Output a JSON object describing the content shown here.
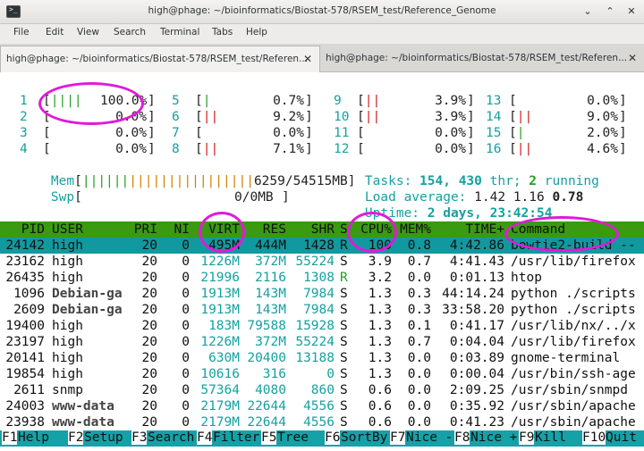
{
  "window": {
    "title": "high@phage: ~/bioinformatics/Biostat-578/RSEM_test/Reference_Genome",
    "minimize": "⌄",
    "maximize": "⌃",
    "close": "✕"
  },
  "menu": [
    "File",
    "Edit",
    "View",
    "Search",
    "Terminal",
    "Tabs",
    "Help"
  ],
  "tabs": [
    {
      "label": "high@phage: ~/bioinformatics/Biostat-578/RSEM_test/Referen...",
      "close": "✕"
    },
    {
      "label": "high@phage: ~/bioinformatics/Biostat-578/RSEM_test/Referen...",
      "close": "✕"
    }
  ],
  "cpus": [
    {
      "id": "1",
      "bars": "||||",
      "pct": "100.0%"
    },
    {
      "id": "2",
      "bars": "",
      "pct": "0.0%"
    },
    {
      "id": "3",
      "bars": "",
      "pct": "0.0%"
    },
    {
      "id": "4",
      "bars": "",
      "pct": "0.0%"
    },
    {
      "id": "5",
      "bars": "|",
      "pct": "0.7%"
    },
    {
      "id": "6",
      "bars": "||",
      "pct": "9.2%"
    },
    {
      "id": "7",
      "bars": "",
      "pct": "0.0%"
    },
    {
      "id": "8",
      "bars": "||",
      "pct": "7.1%"
    },
    {
      "id": "9",
      "bars": "||",
      "pct": "3.9%"
    },
    {
      "id": "10",
      "bars": "||",
      "pct": "3.9%"
    },
    {
      "id": "11",
      "bars": "",
      "pct": "0.0%"
    },
    {
      "id": "12",
      "bars": "",
      "pct": "0.0%"
    },
    {
      "id": "13",
      "bars": "",
      "pct": "0.0%"
    },
    {
      "id": "14",
      "bars": "||",
      "pct": "9.0%"
    },
    {
      "id": "15",
      "bars": "|",
      "pct": "2.0%"
    },
    {
      "id": "16",
      "bars": "||",
      "pct": "4.6%"
    }
  ],
  "mem": {
    "label": "Mem",
    "bars_green": "||||||",
    "bars_orange": "||||||||||||||||",
    "value": "6259/54515MB"
  },
  "swp": {
    "label": "Swp",
    "value": "0/0MB"
  },
  "tasks": {
    "label": "Tasks:",
    "count": "154,",
    "thr": "430",
    "thr_label": "thr;",
    "running": "2",
    "running_label": "running"
  },
  "load": {
    "label": "Load average:",
    "v1": "1.42",
    "v2": "1.16",
    "v3": "0.78"
  },
  "uptime": {
    "label": "Uptime:",
    "value": "2 days, 23:42:54"
  },
  "columns": [
    "PID",
    "USER",
    "PRI",
    "NI",
    "VIRT",
    "RES",
    "SHR",
    "S",
    "CPU%",
    "MEM%",
    "TIME+",
    "Command"
  ],
  "processes": [
    {
      "pid": "24142",
      "user": "high",
      "pri": "20",
      "ni": "0",
      "virt": "495M",
      "res": "444M",
      "shr": "1428",
      "s": "R",
      "cpu": "100",
      "mem": "0.8",
      "time": "4:42.86",
      "cmd": "bowtie2-build --"
    },
    {
      "pid": "23162",
      "user": "high",
      "pri": "20",
      "ni": "0",
      "virt": "1226M",
      "res": "372M",
      "shr": "55224",
      "s": "S",
      "cpu": "3.9",
      "mem": "0.7",
      "time": "4:41.43",
      "cmd": "/usr/lib/firefox"
    },
    {
      "pid": "26435",
      "user": "high",
      "pri": "20",
      "ni": "0",
      "virt": "21996",
      "res": "2116",
      "shr": "1308",
      "s": "R",
      "cpu": "3.2",
      "mem": "0.0",
      "time": "0:01.13",
      "cmd": "htop"
    },
    {
      "pid": "1096",
      "user": "Debian-ga",
      "pri": "20",
      "ni": "0",
      "virt": "1913M",
      "res": "143M",
      "shr": "7984",
      "s": "S",
      "cpu": "1.3",
      "mem": "0.3",
      "time": "44:14.24",
      "cmd": "python ./scripts"
    },
    {
      "pid": "2609",
      "user": "Debian-ga",
      "pri": "20",
      "ni": "0",
      "virt": "1913M",
      "res": "143M",
      "shr": "7984",
      "s": "S",
      "cpu": "1.3",
      "mem": "0.3",
      "time": "33:58.20",
      "cmd": "python ./scripts"
    },
    {
      "pid": "19400",
      "user": "high",
      "pri": "20",
      "ni": "0",
      "virt": "183M",
      "res": "79588",
      "shr": "15928",
      "s": "S",
      "cpu": "1.3",
      "mem": "0.1",
      "time": "0:41.17",
      "cmd": "/usr/lib/nx/../x"
    },
    {
      "pid": "23197",
      "user": "high",
      "pri": "20",
      "ni": "0",
      "virt": "1226M",
      "res": "372M",
      "shr": "55224",
      "s": "S",
      "cpu": "1.3",
      "mem": "0.7",
      "time": "0:04.04",
      "cmd": "/usr/lib/firefox"
    },
    {
      "pid": "20141",
      "user": "high",
      "pri": "20",
      "ni": "0",
      "virt": "630M",
      "res": "20400",
      "shr": "13188",
      "s": "S",
      "cpu": "1.3",
      "mem": "0.0",
      "time": "0:03.89",
      "cmd": "gnome-terminal"
    },
    {
      "pid": "19854",
      "user": "high",
      "pri": "20",
      "ni": "0",
      "virt": "10616",
      "res": "316",
      "shr": "0",
      "s": "S",
      "cpu": "1.3",
      "mem": "0.0",
      "time": "0:00.04",
      "cmd": "/usr/bin/ssh-age"
    },
    {
      "pid": "2611",
      "user": "snmp",
      "pri": "20",
      "ni": "0",
      "virt": "57364",
      "res": "4080",
      "shr": "860",
      "s": "S",
      "cpu": "0.6",
      "mem": "0.0",
      "time": "2:09.25",
      "cmd": "/usr/sbin/snmpd"
    },
    {
      "pid": "24003",
      "user": "www-data",
      "pri": "20",
      "ni": "0",
      "virt": "2179M",
      "res": "22644",
      "shr": "4556",
      "s": "S",
      "cpu": "0.6",
      "mem": "0.0",
      "time": "0:35.92",
      "cmd": "/usr/sbin/apache"
    },
    {
      "pid": "23938",
      "user": "www-data",
      "pri": "20",
      "ni": "0",
      "virt": "2179M",
      "res": "22644",
      "shr": "4556",
      "s": "S",
      "cpu": "0.6",
      "mem": "0.0",
      "time": "0:41.23",
      "cmd": "/usr/sbin/apache"
    }
  ],
  "fkeys": [
    {
      "key": "F1",
      "label": "Help"
    },
    {
      "key": "F2",
      "label": "Setup"
    },
    {
      "key": "F3",
      "label": "Search"
    },
    {
      "key": "F4",
      "label": "Filter"
    },
    {
      "key": "F5",
      "label": "Tree"
    },
    {
      "key": "F6",
      "label": "SortBy"
    },
    {
      "key": "F7",
      "label": "Nice -"
    },
    {
      "key": "F8",
      "label": "Nice +"
    },
    {
      "key": "F9",
      "label": "Kill"
    },
    {
      "key": "F10",
      "label": "Quit"
    }
  ],
  "colors": {
    "header_bg": "#3a9a10",
    "selected_bg": "#12999f",
    "annotation": "#e01ad9",
    "cyan": "#16a0a0",
    "green": "#22a022",
    "red": "#d02020"
  }
}
